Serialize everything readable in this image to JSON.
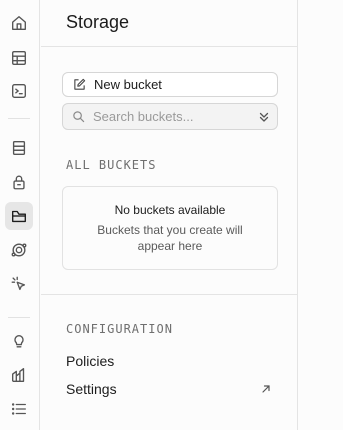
{
  "rail": {
    "icons": [
      "home-icon",
      "table-editor-icon",
      "sql-editor-icon",
      "database-icon",
      "auth-icon",
      "storage-icon",
      "edge-functions-icon",
      "realtime-icon",
      "advisors-icon",
      "reports-icon",
      "logs-icon"
    ],
    "active": "storage-icon"
  },
  "panel": {
    "title": "Storage",
    "new_bucket_label": "New bucket",
    "search_placeholder": "Search buckets...",
    "all_buckets_label": "ALL BUCKETS",
    "empty_title": "No buckets available",
    "empty_text": "Buckets that you create will appear here",
    "configuration_label": "CONFIGURATION",
    "links": [
      {
        "label": "Policies"
      },
      {
        "label": "Settings"
      }
    ]
  },
  "colors": {
    "active_bg": "#e6e6e6",
    "border": "#e4e4e4",
    "text": "#1c1c1c",
    "muted": "#6f6f6f"
  }
}
